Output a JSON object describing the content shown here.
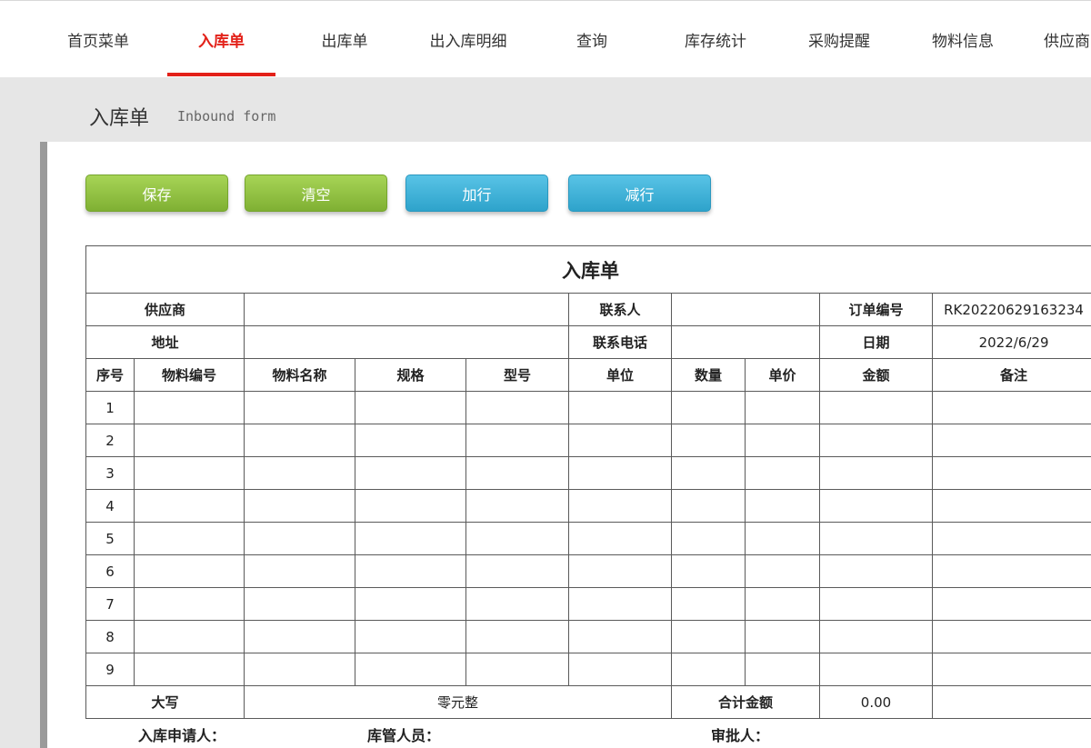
{
  "nav": {
    "items": [
      {
        "label": "首页菜单"
      },
      {
        "label": "入库单"
      },
      {
        "label": "出库单"
      },
      {
        "label": "出入库明细"
      },
      {
        "label": "查询"
      },
      {
        "label": "库存统计"
      },
      {
        "label": "采购提醒"
      },
      {
        "label": "物料信息"
      },
      {
        "label": "供应商"
      }
    ],
    "active_index": 1,
    "accent_color": "#e32119"
  },
  "page": {
    "title": "入库单",
    "subtitle": "Inbound form"
  },
  "toolbar": {
    "save_label": "保存",
    "clear_label": "清空",
    "add_row_label": "加行",
    "remove_row_label": "减行"
  },
  "form": {
    "title": "入库单",
    "supplier_label": "供应商",
    "supplier_value": "",
    "contact_label": "联系人",
    "contact_value": "",
    "order_no_label": "订单编号",
    "order_no_value": "RK20220629163234",
    "address_label": "地址",
    "address_value": "",
    "phone_label": "联系电话",
    "phone_value": "",
    "date_label": "日期",
    "date_value": "2022/6/29",
    "columns": [
      "序号",
      "物料编号",
      "物料名称",
      "规格",
      "型号",
      "单位",
      "数量",
      "单价",
      "金额",
      "备注"
    ],
    "rows": [
      "1",
      "2",
      "3",
      "4",
      "5",
      "6",
      "7",
      "8",
      "9"
    ],
    "capital_label": "大写",
    "capital_value": "零元整",
    "total_label": "合计金额",
    "total_value": "0.00"
  },
  "signatures": {
    "applicant_label": "入库申请人：",
    "keeper_label": "库管人员：",
    "approver_label": "审批人："
  }
}
